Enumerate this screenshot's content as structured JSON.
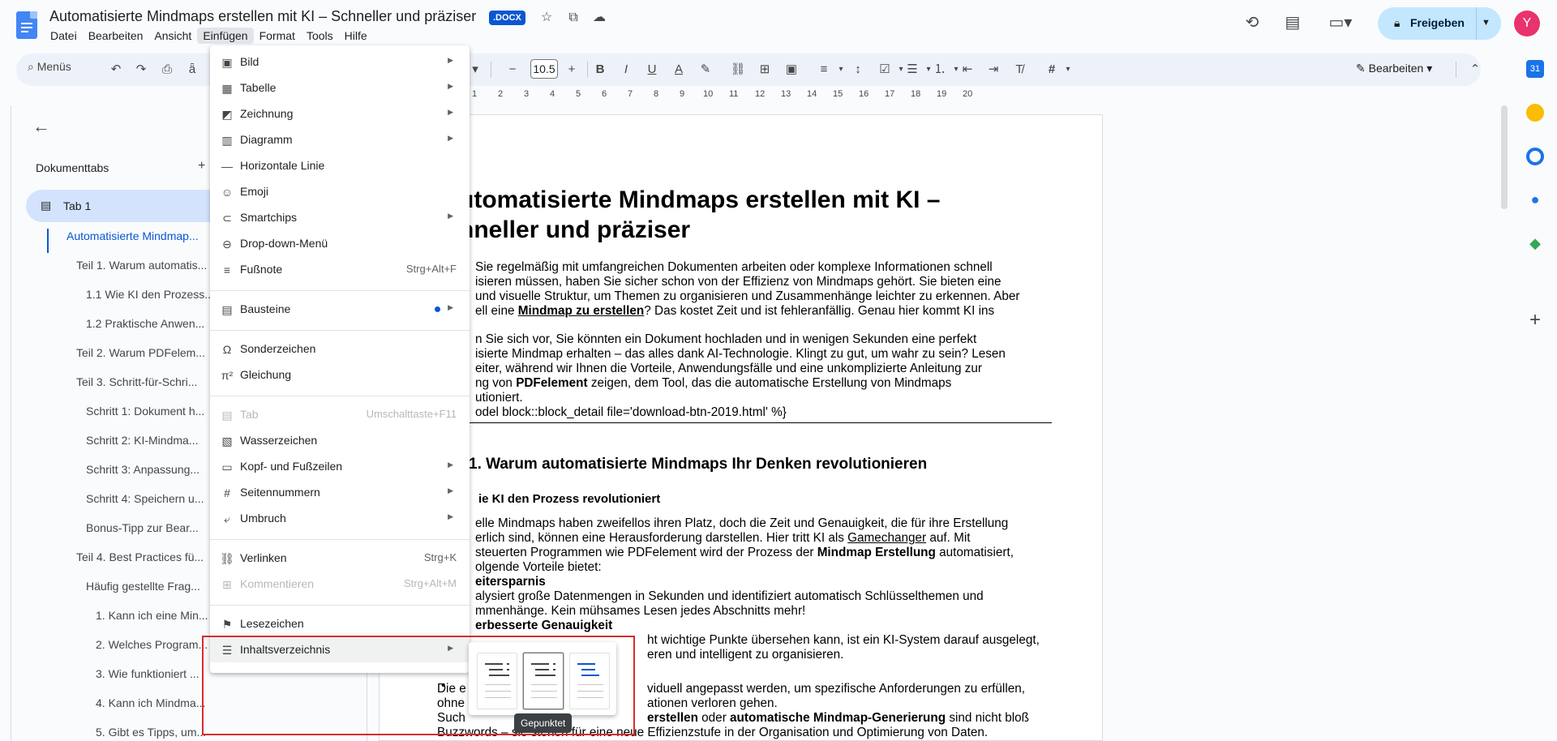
{
  "header": {
    "title": "Automatisierte Mindmaps erstellen mit KI – Schneller und präziser",
    "badge": ".DOCX",
    "share_label": "Freigeben",
    "avatar_letter": "Y"
  },
  "menubar": [
    "Datei",
    "Bearbeiten",
    "Ansicht",
    "Einfügen",
    "Format",
    "Tools",
    "Hilfe"
  ],
  "toolbar": {
    "search_label": "Menüs",
    "font_size": "10.5",
    "mode_label": "Bearbeiten"
  },
  "ruler": [
    "1",
    "2",
    "3",
    "4",
    "5",
    "6",
    "7",
    "8",
    "9",
    "10",
    "11",
    "12",
    "13",
    "14",
    "15",
    "16",
    "17",
    "18",
    "19",
    "20"
  ],
  "sidebar": {
    "heading": "Dokumenttabs",
    "tab_label": "Tab 1",
    "outline": [
      "Automatisierte Mindmap...",
      "Teil 1. Warum automatis...",
      "1.1 Wie KI den Prozess...",
      "1.2 Praktische Anwen...",
      "Teil 2. Warum PDFelem...",
      "Teil 3. Schritt-für-Schri...",
      "Schritt 1: Dokument h...",
      "Schritt 2: KI-Mindma...",
      "Schritt 3: Anpassung...",
      "Schritt 4: Speichern u...",
      "Bonus-Tipp zur Bear...",
      "Teil 4. Best Practices fü...",
      "Häufig gestellte Frag...",
      "1. Kann ich eine Min...",
      "2. Welches Program...",
      "3. Wie funktioniert ...",
      "4. Kann ich Mindma...",
      "5. Gibt es Tipps, um..."
    ]
  },
  "document": {
    "h1_line1": "utomatisierte Mindmaps erstellen mit KI –",
    "h1_line2": "hneller und präziser",
    "p1": [
      "Sie regelmäßig mit umfangreichen Dokumenten arbeiten oder komplexe Informationen schnell",
      "isieren müssen, haben Sie sicher schon von der Effizienz von Mindmaps gehört. Sie bieten eine",
      "und visuelle Struktur, um Themen zu organisieren und Zusammenhänge leichter zu erkennen. Aber",
      "ell eine",
      "Mindmap zu erstellen",
      "? Das kostet Zeit und ist fehleranfällig. Genau hier kommt KI ins"
    ],
    "p2": [
      "n Sie sich vor, Sie könnten ein Dokument hochladen und in wenigen Sekunden eine perfekt",
      "isierte Mindmap erhalten – das alles dank AI-Technologie. Klingt zu gut, um wahr zu sein? Lesen",
      "eiter, während wir Ihnen die Vorteile, Anwendungsfälle und eine unkomplizierte Anleitung zur",
      "ng von",
      "PDFelement",
      "zeigen, dem Tool, das die automatische Erstellung von Mindmaps",
      "utioniert.",
      "odel block::block_detail file='download-btn-2019.html' %}"
    ],
    "h2": "1. Warum automatisierte Mindmaps Ihr Denken revolutionieren",
    "h3": "ie KI den Prozess revolutioniert",
    "p3": [
      "elle Mindmaps haben zweifellos ihren Platz, doch die Zeit und Genauigkeit, die für ihre Erstellung",
      "erlich sind, können eine Herausforderung darstellen. Hier tritt KI als",
      "Gamechanger",
      "auf. Mit",
      "steuerten Programmen wie PDFelement wird der Prozess der",
      "Mindmap Erstellung",
      "automatisiert,",
      "olgende Vorteile bietet:"
    ],
    "b1_title": "eitersparnis",
    "b1": [
      "alysiert große Datenmengen in Sekunden und identifiziert automatisch Schlüsselthemen und",
      "mmenhänge. Kein mühsames Lesen jedes Abschnitts mehr!"
    ],
    "b2_title": "erbesserte Genauigkeit",
    "b2": [
      "ht wichtige Punkte übersehen kann, ist ein KI-System darauf ausgelegt,",
      "eren und intelligent zu organisieren."
    ],
    "tail": [
      "Die e",
      "viduell angepasst werden, um spezifische Anforderungen zu erfüllen,",
      "ohne",
      "ationen verloren gehen.",
      "Such",
      "erstellen",
      "oder",
      "automatische Mindmap-Generierung",
      "sind nicht bloß",
      "Buzzwords – sie stehen für eine neue Effizienzstufe in der Organisation und Optimierung von Daten."
    ]
  },
  "insert_menu": {
    "items": [
      {
        "label": "Bild",
        "icon": "image-icon",
        "shortcut": "",
        "submenu": true,
        "disabled": false
      },
      {
        "label": "Tabelle",
        "icon": "table-icon",
        "shortcut": "",
        "submenu": true,
        "disabled": false
      },
      {
        "label": "Zeichnung",
        "icon": "drawing-icon",
        "shortcut": "",
        "submenu": true,
        "disabled": false
      },
      {
        "label": "Diagramm",
        "icon": "chart-icon",
        "shortcut": "",
        "submenu": true,
        "disabled": false
      },
      {
        "label": "Horizontale Linie",
        "icon": "horizontal-line-icon",
        "shortcut": "",
        "submenu": false,
        "disabled": false
      },
      {
        "label": "Emoji",
        "icon": "emoji-icon",
        "shortcut": "",
        "submenu": false,
        "disabled": false
      },
      {
        "label": "Smartchips",
        "icon": "smartchips-icon",
        "shortcut": "",
        "submenu": true,
        "disabled": false
      },
      {
        "label": "Drop-down-Menü",
        "icon": "dropdown-icon",
        "shortcut": "",
        "submenu": false,
        "disabled": false
      },
      {
        "label": "Fußnote",
        "icon": "footnote-icon",
        "shortcut": "Strg+Alt+F",
        "submenu": false,
        "disabled": false
      },
      {
        "label": "Bausteine",
        "icon": "building-blocks-icon",
        "shortcut": "",
        "submenu": true,
        "disabled": false
      },
      {
        "label": "Sonderzeichen",
        "icon": "omega-icon",
        "shortcut": "",
        "submenu": false,
        "disabled": false
      },
      {
        "label": "Gleichung",
        "icon": "pi-icon",
        "shortcut": "",
        "submenu": false,
        "disabled": false
      },
      {
        "label": "Tab",
        "icon": "tab-icon",
        "shortcut": "Umschalttaste+F11",
        "submenu": false,
        "disabled": true
      },
      {
        "label": "Wasserzeichen",
        "icon": "watermark-icon",
        "shortcut": "",
        "submenu": false,
        "disabled": false
      },
      {
        "label": "Kopf- und Fußzeilen",
        "icon": "header-footer-icon",
        "shortcut": "",
        "submenu": true,
        "disabled": false
      },
      {
        "label": "Seitennummern",
        "icon": "hash-icon",
        "shortcut": "",
        "submenu": true,
        "disabled": false
      },
      {
        "label": "Umbruch",
        "icon": "break-icon",
        "shortcut": "",
        "submenu": true,
        "disabled": false
      },
      {
        "label": "Verlinken",
        "icon": "link-icon",
        "shortcut": "Strg+K",
        "submenu": false,
        "disabled": false
      },
      {
        "label": "Kommentieren",
        "icon": "comment-add-icon",
        "shortcut": "Strg+Alt+M",
        "submenu": false,
        "disabled": true
      },
      {
        "label": "Lesezeichen",
        "icon": "bookmark-icon",
        "shortcut": "",
        "submenu": false,
        "disabled": false
      },
      {
        "label": "Inhaltsverzeichnis",
        "icon": "toc-icon",
        "shortcut": "",
        "submenu": true,
        "disabled": false
      }
    ]
  },
  "toc_submenu": {
    "tooltip": "Gepunktet"
  },
  "colors": {
    "accent": "#0b57d0",
    "share_bg": "#c2e7ff",
    "highlight_border": "#d92c2c"
  }
}
